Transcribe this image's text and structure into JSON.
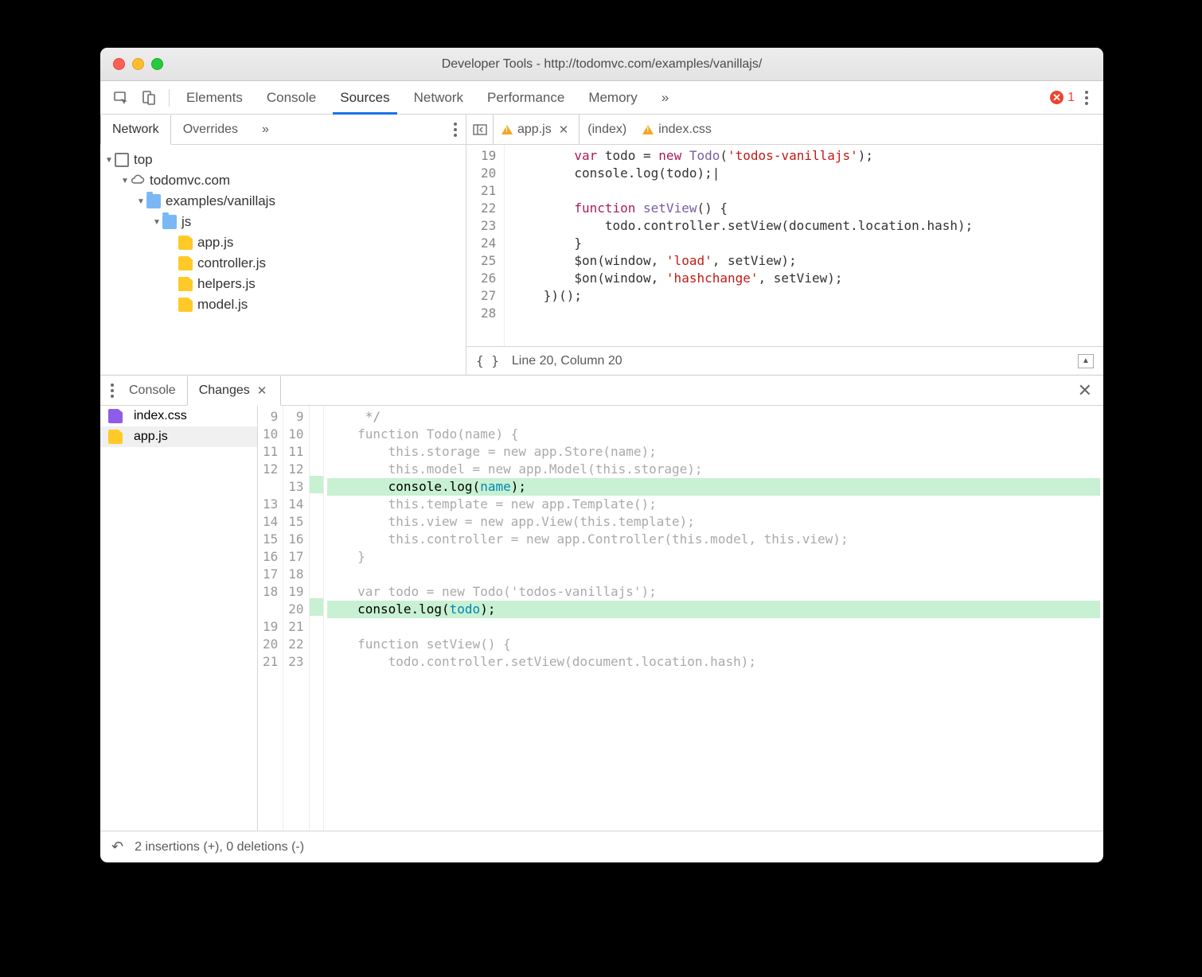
{
  "window": {
    "title": "Developer Tools - http://todomvc.com/examples/vanillajs/"
  },
  "toolbar": {
    "tabs": [
      "Elements",
      "Console",
      "Sources",
      "Network",
      "Performance",
      "Memory"
    ],
    "active": "Sources",
    "overflow": "»",
    "error_count": "1"
  },
  "nav": {
    "tabs": [
      "Network",
      "Overrides"
    ],
    "active": "Network",
    "overflow": "»",
    "tree": {
      "top": "top",
      "domain": "todomvc.com",
      "folder": "examples/vanillajs",
      "subfolder": "js",
      "files": [
        "app.js",
        "controller.js",
        "helpers.js",
        "model.js"
      ]
    }
  },
  "source": {
    "tabs": [
      {
        "name": "app.js",
        "warn": true,
        "active": true,
        "closable": true
      },
      {
        "name": "(index)",
        "warn": false,
        "active": false,
        "closable": false
      },
      {
        "name": "index.css",
        "warn": true,
        "active": false,
        "closable": false
      }
    ],
    "gutter": [
      "19",
      "20",
      "21",
      "22",
      "23",
      "24",
      "25",
      "26",
      "27",
      "28"
    ],
    "code": {
      "l19": {
        "pre": "        ",
        "k": "var",
        "t1": " todo = ",
        "k2": "new",
        "t2": " ",
        "fn": "Todo",
        "t3": "(",
        "s": "'todos-vanillajs'",
        "t4": ");"
      },
      "l20": {
        "pre": "        ",
        "t": "console.log(todo);|"
      },
      "l21": {
        "pre": ""
      },
      "l22": {
        "pre": "        ",
        "k": "function",
        "t1": " ",
        "fn": "setView",
        "t2": "() {"
      },
      "l23": {
        "pre": "            ",
        "t": "todo.controller.setView(document.location.hash);"
      },
      "l24": {
        "pre": "        ",
        "t": "}"
      },
      "l25": {
        "pre": "        ",
        "t1": "$on(window, ",
        "s": "'load'",
        "t2": ", setView);"
      },
      "l26": {
        "pre": "        ",
        "t1": "$on(window, ",
        "s": "'hashchange'",
        "t2": ", setView);"
      },
      "l27": {
        "pre": "    ",
        "t": "})();"
      }
    },
    "footer": {
      "brackets": "{ }",
      "status": "Line 20, Column 20"
    }
  },
  "drawer": {
    "tabs": [
      "Console",
      "Changes"
    ],
    "active": "Changes",
    "files": [
      {
        "name": "index.css",
        "icon": "p"
      },
      {
        "name": "app.js",
        "icon": "y",
        "selected": true
      }
    ],
    "diff": {
      "left": [
        "9",
        "10",
        "11",
        "12",
        "",
        "13",
        "14",
        "15",
        "16",
        "17",
        "18",
        "",
        "19",
        "20",
        "21"
      ],
      "right": [
        "9",
        "10",
        "11",
        "12",
        "13",
        "14",
        "15",
        "16",
        "17",
        "18",
        "19",
        "20",
        "21",
        "22",
        "23"
      ],
      "lines": [
        {
          "t": "     */",
          "cls": "cmt"
        },
        {
          "raw": "    <span class='kw gr'>function</span> <span class='fn gr'>Todo</span><span class='gr'>(</span><span class='id gr'>name</span><span class='gr'>) {</span>"
        },
        {
          "raw": "        <span class='kw gr'>this</span><span class='gr'>.storage = </span><span class='kw gr'>new</span><span class='gr'> app.Store(name);</span>"
        },
        {
          "raw": "        <span class='kw gr'>this</span><span class='gr'>.model = </span><span class='kw gr'>new</span><span class='gr'> app.Model(</span><span class='kw gr'>this</span><span class='gr'>.storage);</span>"
        },
        {
          "raw": "        console.log(<span class='id'>name</span>);",
          "add": true
        },
        {
          "raw": "        <span class='kw gr'>this</span><span class='gr'>.template = </span><span class='kw gr'>new</span><span class='gr'> app.Template();</span>"
        },
        {
          "raw": "        <span class='kw gr'>this</span><span class='gr'>.view = </span><span class='kw gr'>new</span><span class='gr'> app.View(</span><span class='kw gr'>this</span><span class='gr'>.template);</span>"
        },
        {
          "raw": "        <span class='kw gr'>this</span><span class='gr'>.controller = </span><span class='kw gr'>new</span><span class='gr'> app.Controller(</span><span class='kw gr'>this</span><span class='gr'>.model, </span><span class='kw gr'>this</span><span class='gr'>.view);</span>"
        },
        {
          "raw": "<span class='gr'>    }</span>"
        },
        {
          "raw": ""
        },
        {
          "raw": "    <span class='kw gr'>var</span><span class='gr'> todo = </span><span class='kw gr'>new</span><span class='gr'> Todo(</span><span class='str gr'>'todos-vanillajs'</span><span class='gr'>);</span>"
        },
        {
          "raw": "    console.log(<span class='id'>todo</span>);",
          "add": true
        },
        {
          "raw": ""
        },
        {
          "raw": "    <span class='kw gr'>function</span> <span class='fn gr'>setView</span><span class='gr'>() {</span>"
        },
        {
          "raw": "<span class='gr'>        todo.controller.setView(document.location.hash);</span>"
        }
      ]
    },
    "footer": "2 insertions (+), 0 deletions (-)"
  }
}
